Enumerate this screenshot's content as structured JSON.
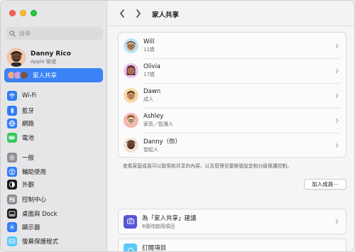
{
  "sidebar": {
    "search_placeholder": "搜尋",
    "profile": {
      "name": "Danny Rico",
      "subtitle": "Apple 帳號"
    },
    "family_label": "家人共享",
    "items": [
      {
        "label": "Wi-Fi",
        "icon": "wifi-icon",
        "color": "#2f7cf6"
      },
      {
        "label": "藍牙",
        "icon": "bluetooth-icon",
        "color": "#2f7cf6"
      },
      {
        "label": "網路",
        "icon": "globe-icon",
        "color": "#2f7cf6"
      },
      {
        "label": "電池",
        "icon": "battery-icon",
        "color": "#34c759"
      },
      {
        "label": "一般",
        "icon": "gear-icon",
        "color": "#8e8e93"
      },
      {
        "label": "輔助使用",
        "icon": "accessibility-icon",
        "color": "#2f7cf6"
      },
      {
        "label": "外觀",
        "icon": "appearance-icon",
        "color": "#1d1d1f"
      },
      {
        "label": "控制中心",
        "icon": "control-center-icon",
        "color": "#8e8e93"
      },
      {
        "label": "桌面與 Dock",
        "icon": "dock-icon",
        "color": "#1d1d1f"
      },
      {
        "label": "顯示器",
        "icon": "display-icon",
        "color": "#2f7cf6"
      },
      {
        "label": "螢幕保護程式",
        "icon": "screensaver-icon",
        "color": "#5ac8fa"
      }
    ]
  },
  "toolbar": {
    "title": "家人共享"
  },
  "members": [
    {
      "name": "Will",
      "role": "12歲"
    },
    {
      "name": "Olivia",
      "role": "17歲"
    },
    {
      "name": "Dawn",
      "role": "成人"
    },
    {
      "name": "Ashley",
      "role": "家長／監護人"
    },
    {
      "name": "Danny（你）",
      "role": "發起人"
    }
  ],
  "members_description": "查看家庭成員可以取用和共享的內容，以及管理兒童帳號設定和分級保護控制。",
  "add_member_label": "加入成員⋯",
  "suggestions": {
    "title": "為「家人共享」建議",
    "subtitle": "6個待啟用項目"
  },
  "subscriptions": {
    "title": "訂閱項目"
  },
  "colors": {
    "accent": "#3a82f6",
    "suggestion_icon": "#5856d6"
  }
}
